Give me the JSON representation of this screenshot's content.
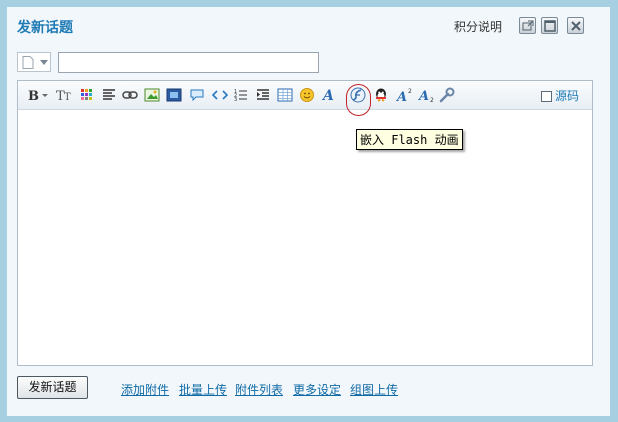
{
  "dialog": {
    "title": "发新话题",
    "score_help": "积分说明"
  },
  "subject": {
    "value": ""
  },
  "toolbar": {
    "buttons": [
      "bold-icon",
      "font-size-icon",
      "font-type-icon",
      "color-grid-icon",
      "align-icon",
      "link-icon",
      "image-icon",
      "video-icon",
      "quote-icon",
      "code-icon",
      "ordered-list-icon",
      "indent-icon",
      "table-icon",
      "smiley-icon",
      "font-a-icon",
      "flash-icon",
      "qq-icon",
      "superscript-icon",
      "subscript-icon",
      "wrench-icon"
    ],
    "source_label": "源码"
  },
  "tooltip": {
    "text": "嵌入 Flash 动画"
  },
  "footer": {
    "post_button": "发新话题",
    "links": [
      "添加附件",
      "批量上传",
      "附件列表",
      "更多设定",
      "组图上传"
    ]
  },
  "colors": {
    "title": "#1e7bb5",
    "frame": "#a6cfe2",
    "highlight_ring": "#c0262c",
    "link": "#0f6aa6"
  }
}
